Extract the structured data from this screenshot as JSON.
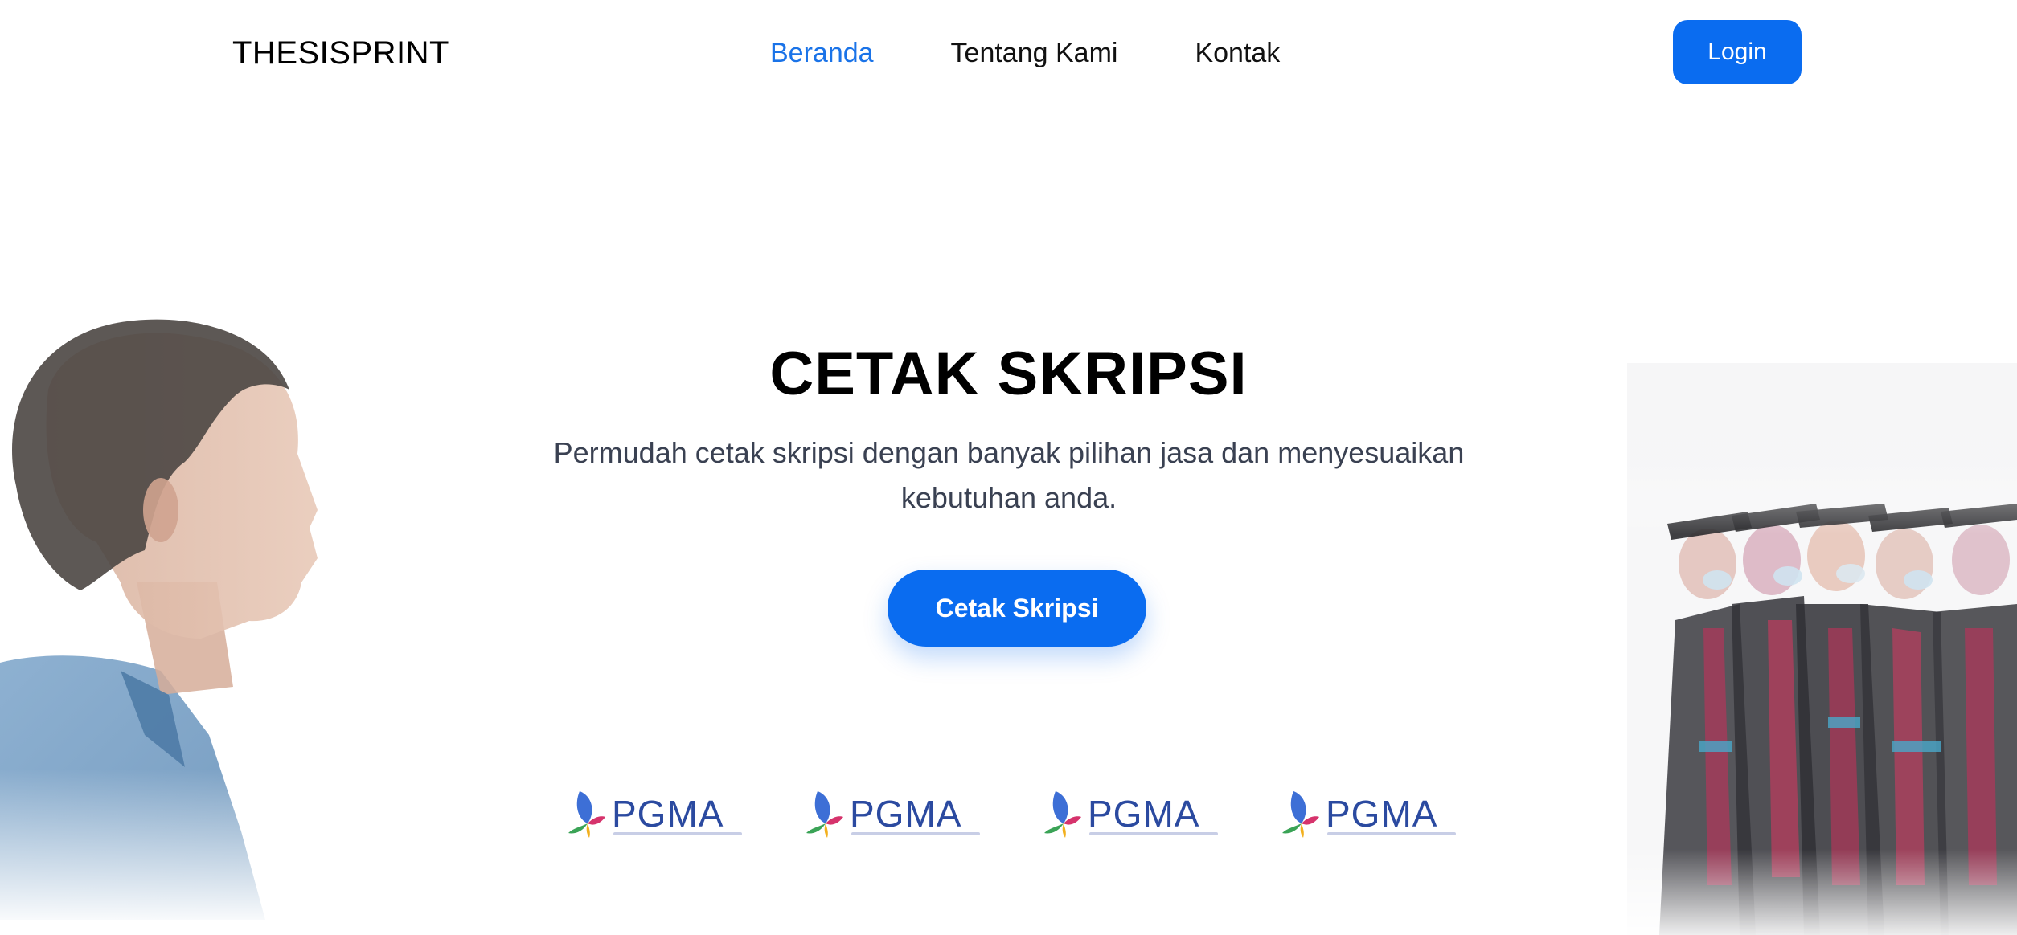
{
  "navbar": {
    "brand": "THESISPRINT",
    "links": [
      {
        "label": "Beranda",
        "active": true
      },
      {
        "label": "Tentang Kami",
        "active": false
      },
      {
        "label": "Kontak",
        "active": false
      }
    ],
    "login_label": "Login"
  },
  "hero": {
    "title": "CETAK SKRIPSI",
    "subtitle": "Permudah cetak skripsi dengan banyak pilihan jasa dan menyesuaikan kebutuhan anda.",
    "cta_label": "Cetak Skripsi"
  },
  "partners": [
    {
      "name": "PGMA"
    },
    {
      "name": "PGMA"
    },
    {
      "name": "PGMA"
    },
    {
      "name": "PGMA"
    }
  ],
  "colors": {
    "accent": "#0a6cf0",
    "active_link": "#1a73e8",
    "subtitle_text": "#3a4152",
    "partner_logo": "#2b4aa0"
  },
  "images": {
    "left": "man-profile-photo",
    "right": "graduates-photo"
  }
}
